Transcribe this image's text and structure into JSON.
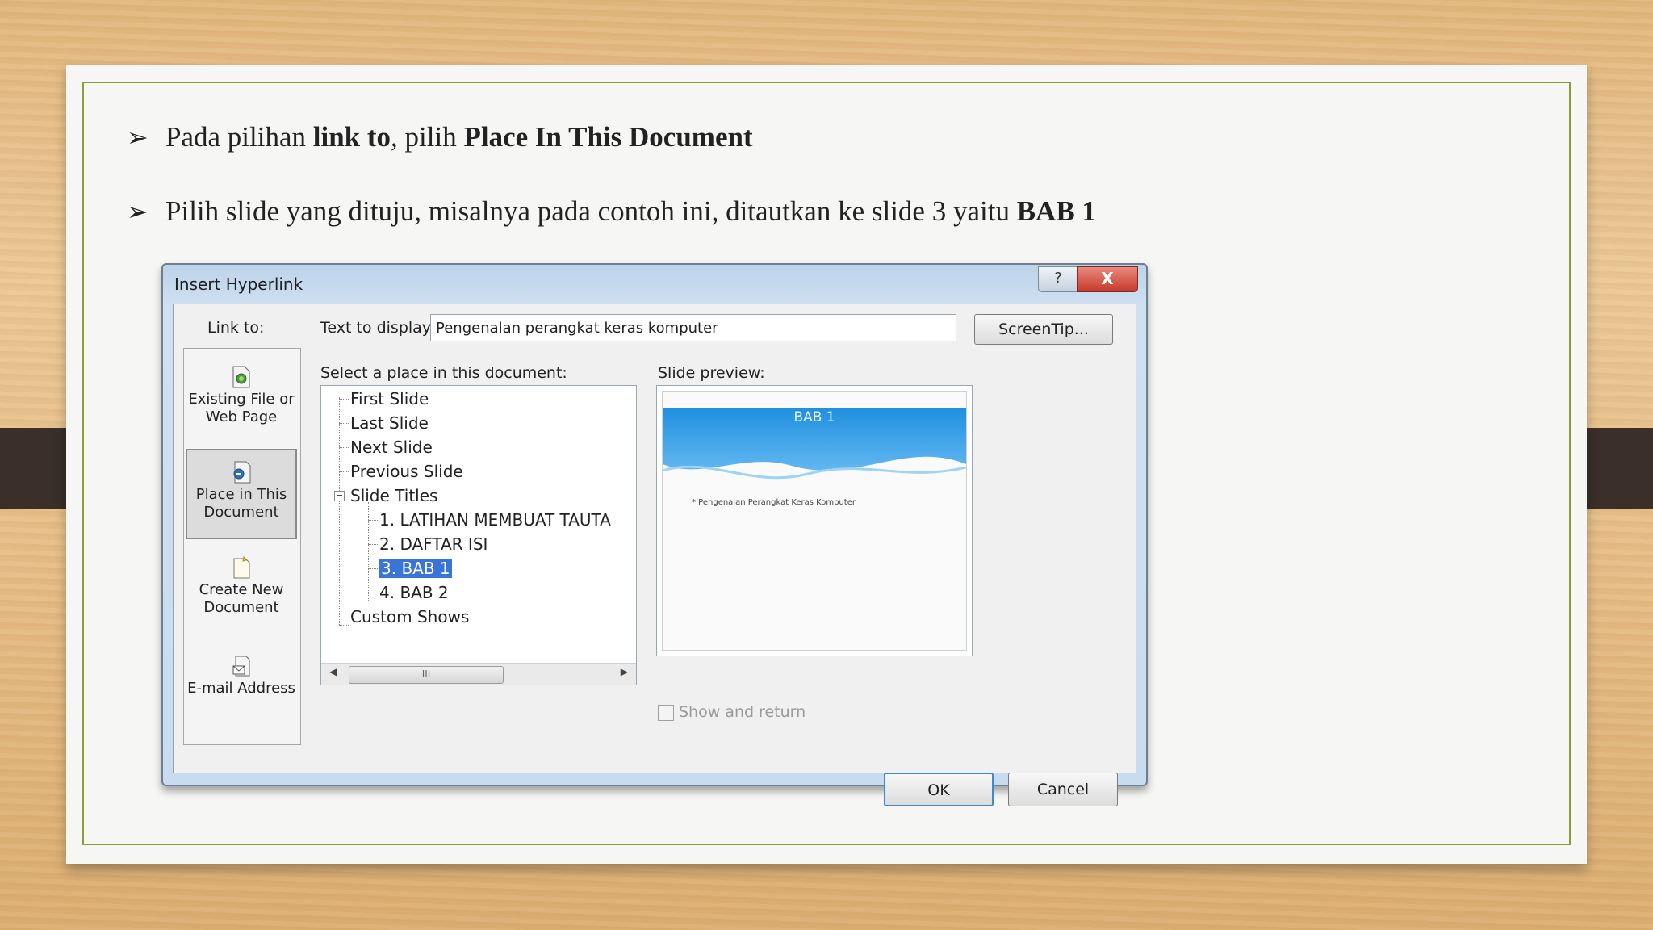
{
  "slide": {
    "bullet1": {
      "prefix": "Pada pilihan ",
      "bold1": "link to",
      "middle": ", pilih ",
      "bold2": "Place In This Document"
    },
    "bullet2": {
      "prefix": "Pilih slide yang dituju, misalnya pada contoh ini, ditautkan ke slide 3 yaitu ",
      "bold": "BAB 1"
    },
    "arrow_glyph": "➢"
  },
  "dialog": {
    "title": "Insert Hyperlink",
    "help_label": "?",
    "close_label": "X",
    "link_to_label": "Link to:",
    "sidebar": [
      {
        "line1": "Existing File or",
        "line2": "Web Page",
        "icon": "existing-file-icon"
      },
      {
        "line1": "Place in This",
        "line2": "Document",
        "icon": "place-in-document-icon",
        "active": true
      },
      {
        "line1": "Create New",
        "line2": "Document",
        "icon": "new-document-icon"
      },
      {
        "line1": "E-mail Address",
        "line2": "",
        "icon": "email-icon"
      }
    ],
    "text_to_display_label": "Text to display:",
    "text_to_display_value": "Pengenalan perangkat keras komputer",
    "screentip_label": "ScreenTip...",
    "select_place_label": "Select a place in this document:",
    "tree": [
      "First Slide",
      "Last Slide",
      "Next Slide",
      "Previous Slide",
      "Slide Titles",
      "1. LATIHAN MEMBUAT TAUTA",
      "2. DAFTAR ISI",
      "3. BAB 1",
      "4. BAB 2",
      "Custom Shows"
    ],
    "tree_selected_index": 7,
    "expander_glyph": "−",
    "scroll_thumb_glyph": "III",
    "scroll_left_glyph": "◀",
    "scroll_right_glyph": "▶",
    "slide_preview_label": "Slide preview:",
    "preview": {
      "title": "BAB 1",
      "text": "* Pengenalan Perangkat Keras Komputer"
    },
    "show_and_return_label": "Show and return",
    "ok_label": "OK",
    "cancel_label": "Cancel"
  }
}
